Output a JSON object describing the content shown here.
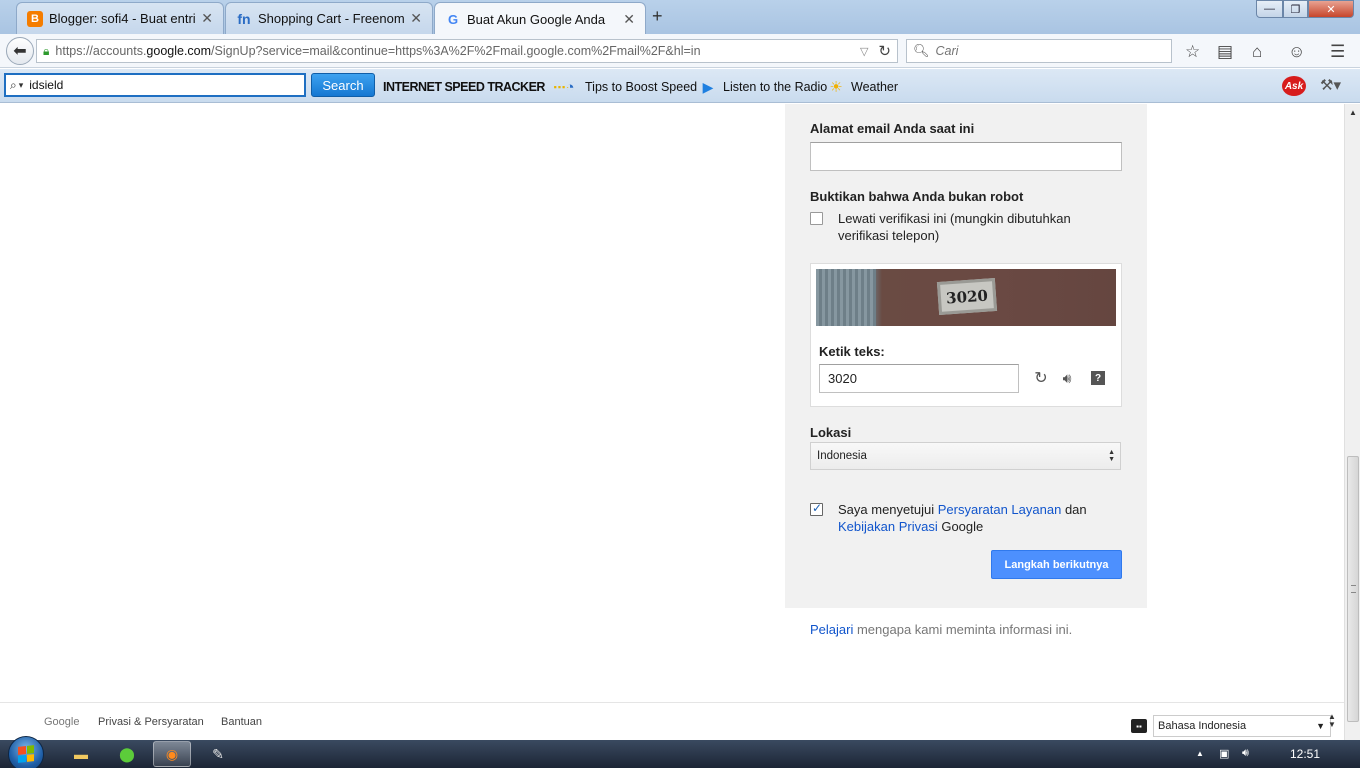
{
  "tabs": [
    {
      "label": "Blogger: sofi4 - Buat entri",
      "icon": "blogger-icon",
      "color": "#f57d00"
    },
    {
      "label": "Shopping Cart - Freenom",
      "icon": "freenom-icon",
      "color": "#2a6cc4"
    },
    {
      "label": "Buat Akun Google Anda",
      "icon": "google-icon",
      "color": "#4285f4",
      "active": true
    }
  ],
  "navbar": {
    "url_prefix": "https://accounts.",
    "url_domain": "google.com",
    "url_rest": "/SignUp?service=mail&continue=https%3A%2F%2Fmail.google.com%2Fmail%2F&hl=in",
    "search_placeholder": "Cari"
  },
  "ask_toolbar": {
    "search_value": "idsield",
    "search_button": "Search",
    "speed_tracker": "INTERNET SPEED TRACKER",
    "tips": "Tips to Boost Speed",
    "radio": "Listen to the Radio",
    "weather": "Weather",
    "ask_logo": "Ask"
  },
  "form": {
    "current_email_label": "Alamat email Anda saat ini",
    "current_email_value": "",
    "robot_label": "Buktikan bahwa Anda bukan robot",
    "skip_line1": "Lewati verifikasi ini (mungkin dibutuhkan",
    "skip_line2": "verifikasi telepon)",
    "skip_checked": false,
    "captcha_image_text": "3020",
    "captcha_label": "Ketik teks:",
    "captcha_value": "3020",
    "location_label": "Lokasi",
    "location_value": "Indonesia",
    "agree_prefix": "Saya menyetujui ",
    "agree_tos": "Persyaratan Layanan",
    "agree_mid": " dan",
    "agree_privacy": "Kebijakan Privasi",
    "agree_suffix": " Google",
    "agree_checked": true,
    "next_button": "Langkah berikutnya"
  },
  "learn_more": {
    "link": "Pelajari",
    "text": " mengapa kami meminta informasi ini."
  },
  "footer": {
    "google": "Google",
    "privacy": "Privasi & Persyaratan",
    "help": "Bantuan",
    "language": "Bahasa Indonesia"
  },
  "taskbar": {
    "clock": "12:51"
  },
  "colors": {
    "accent_blue": "#4d90fe",
    "link_blue": "#1155cc",
    "card_bg": "#f1f1f1"
  }
}
